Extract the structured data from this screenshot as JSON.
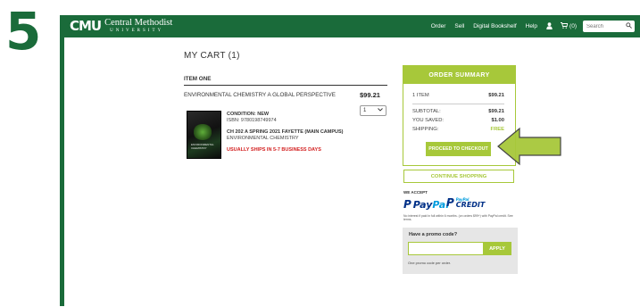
{
  "step": {
    "number": "5"
  },
  "header": {
    "logo_mark": "CMU",
    "logo_name": "Central Methodist",
    "logo_sub": "UNIVERSITY",
    "nav": [
      "Order",
      "Sell",
      "Digital Bookshelf",
      "Help"
    ],
    "user_icon": "user-icon",
    "cart_count": "(0)",
    "search_placeholder": "Search"
  },
  "cart": {
    "title": "MY CART (1)",
    "item_heading": "ITEM ONE",
    "item_title": "ENVIRONMENTAL CHEMISTRY A GLOBAL PERSPECTIVE",
    "item_price": "$99.21",
    "quantity": "1",
    "condition": "CONDITION: NEW",
    "isbn": "ISBN: 9780198749974",
    "course": "CH 202 A  SPRING 2021 FAYETTE (MAIN CAMPUS)",
    "course_name": "ENVIRONMENTAL CHEMISTRY",
    "ship_note": "USUALLY SHIPS IN 5-7 BUSINESS DAYS",
    "cover_text": "ENVIRONMENTAL CHEMISTRY"
  },
  "summary": {
    "title": "ORDER SUMMARY",
    "items_label": "1 ITEM",
    "items_value": "$99.21",
    "subtotal_label": "SUBTOTAL:",
    "subtotal_value": "$99.21",
    "saved_label": "YOU SAVED:",
    "saved_value": "$1.00",
    "shipping_label": "SHIPPING:",
    "shipping_value": "FREE",
    "checkout_label": "PROCEED TO CHECKOUT",
    "continue_label": "CONTINUE SHOPPING"
  },
  "payment": {
    "we_accept": "WE ACCEPT",
    "paypal_mark": "P",
    "paypal_pay": "Pay",
    "paypal_pal": "Pal",
    "paypal_credit_small": "PayPal",
    "paypal_credit_big": "CREDIT",
    "note": "No interest if paid in full within 6 months. (on orders $99+) with PayPal credit. See terms."
  },
  "promo": {
    "title": "Have a promo code?",
    "apply_label": "APPLY",
    "note": "One promo code per order."
  },
  "colors": {
    "brand_green": "#1a6b3a",
    "accent_lime": "#a7c83a",
    "warning_red": "#d32020",
    "paypal_blue": "#003087"
  }
}
